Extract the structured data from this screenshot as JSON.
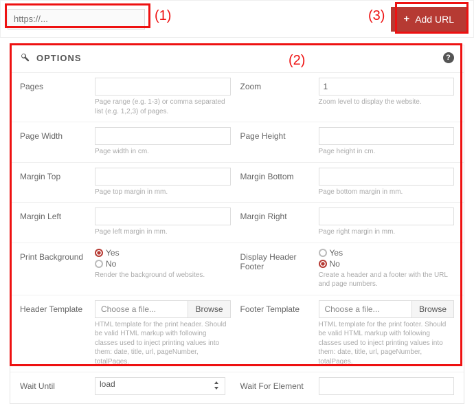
{
  "annotations": {
    "m1": "(1)",
    "m2": "(2)",
    "m3": "(3)"
  },
  "top": {
    "url_placeholder": "https://...",
    "add_url_label": "Add URL"
  },
  "options": {
    "title": "OPTIONS",
    "help_char": "?",
    "fields": {
      "pages": {
        "label": "Pages",
        "help": "Page range (e.g. 1-3) or comma separated list (e.g. 1,2,3) of pages."
      },
      "zoom": {
        "label": "Zoom",
        "value": "1",
        "help": "Zoom level to display the website."
      },
      "page_width": {
        "label": "Page Width",
        "help": "Page width in cm."
      },
      "page_height": {
        "label": "Page Height",
        "help": "Page height in cm."
      },
      "margin_top": {
        "label": "Margin Top",
        "help": "Page top margin in mm."
      },
      "margin_bottom": {
        "label": "Margin Bottom",
        "help": "Page bottom margin in mm."
      },
      "margin_left": {
        "label": "Margin Left",
        "help": "Page left margin in mm."
      },
      "margin_right": {
        "label": "Margin Right",
        "help": "Page right margin in mm."
      },
      "print_bg": {
        "label": "Print Background",
        "yes": "Yes",
        "no": "No",
        "selected": "yes",
        "help": "Render the background of websites."
      },
      "display_hf": {
        "label": "Display Header Footer",
        "yes": "Yes",
        "no": "No",
        "selected": "no",
        "help": "Create a header and a footer with the URL and page numbers."
      },
      "header_tpl": {
        "label": "Header Template",
        "file_label": "Choose a file...",
        "browse": "Browse",
        "help": "HTML template for the print header. Should be valid HTML markup with following classes used to inject printing values into them: date, title, url, pageNumber, totalPages."
      },
      "footer_tpl": {
        "label": "Footer Template",
        "file_label": "Choose a file...",
        "browse": "Browse",
        "help": "HTML template for the print footer. Should be valid HTML markup with following classes used to inject printing values into them: date, title, url, pageNumber, totalPages."
      },
      "wait_until": {
        "label": "Wait Until",
        "value": "load"
      },
      "wait_for_el": {
        "label": "Wait For Element"
      }
    }
  }
}
